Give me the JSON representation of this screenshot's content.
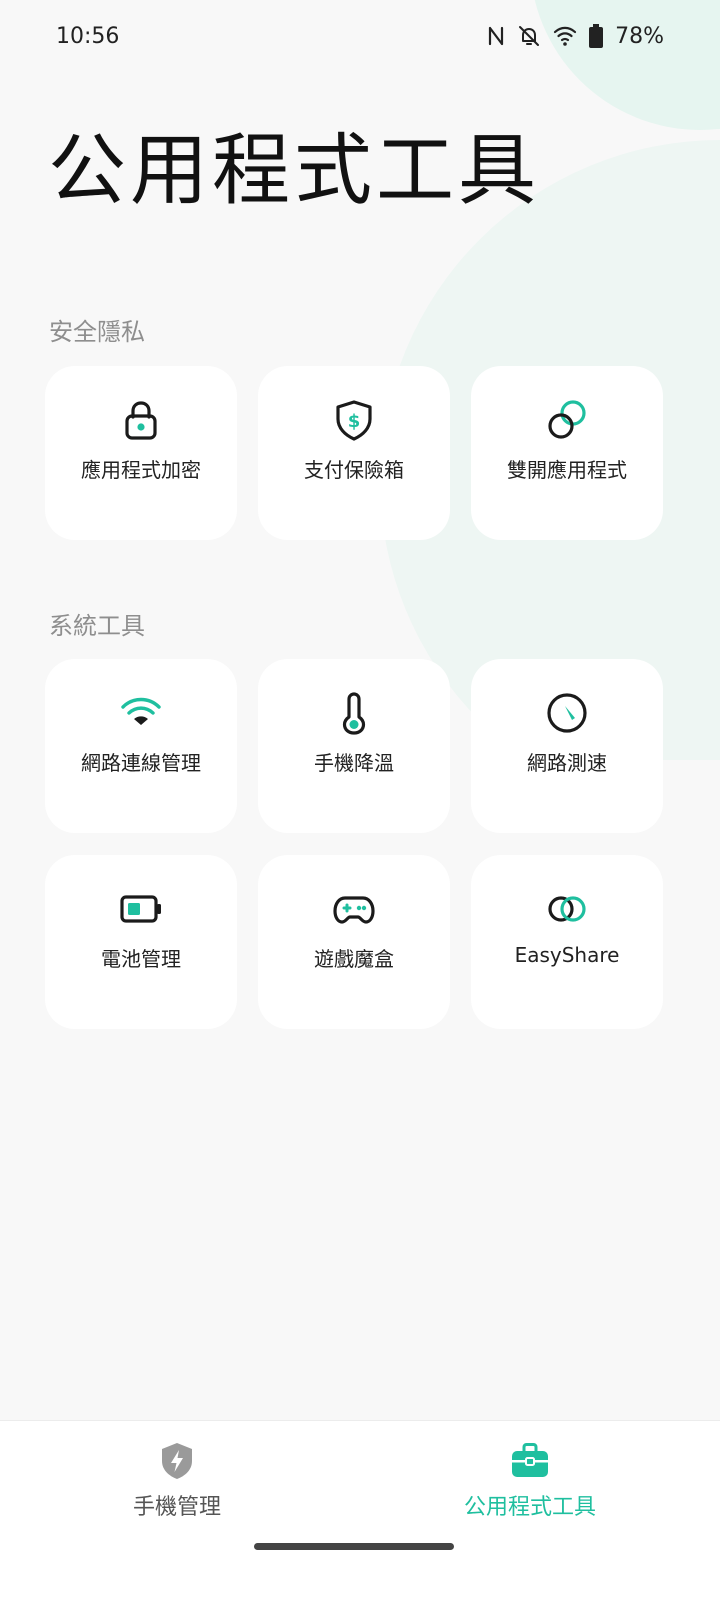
{
  "status_bar": {
    "time": "10:56",
    "battery_percent": "78%",
    "icons": [
      "nfc-icon",
      "bell-off-icon",
      "wifi-icon",
      "battery-icon"
    ]
  },
  "header": {
    "title": "公用程式工具"
  },
  "sections": [
    {
      "label": "安全隱私",
      "tiles": [
        {
          "label": "應用程式加密",
          "icon": "lock-icon"
        },
        {
          "label": "支付保險箱",
          "icon": "shield-dollar-icon"
        },
        {
          "label": "雙開應用程式",
          "icon": "dual-circle-icon"
        }
      ]
    },
    {
      "label": "系統工具",
      "tiles": [
        {
          "label": "網路連線管理",
          "icon": "wifi-icon"
        },
        {
          "label": "手機降溫",
          "icon": "thermometer-icon"
        },
        {
          "label": "網路測速",
          "icon": "speedometer-icon"
        },
        {
          "label": "電池管理",
          "icon": "battery-icon"
        },
        {
          "label": "遊戲魔盒",
          "icon": "gamepad-icon"
        },
        {
          "label": "EasyShare",
          "icon": "link-circles-icon"
        }
      ]
    }
  ],
  "bottom_nav": {
    "items": [
      {
        "label": "手機管理",
        "icon": "shield-bolt-icon",
        "active": false
      },
      {
        "label": "公用程式工具",
        "icon": "toolbox-icon",
        "active": true
      }
    ]
  },
  "colors": {
    "accent": "#1fbf9f",
    "dark": "#1b1b1b",
    "inactive": "#555555"
  }
}
